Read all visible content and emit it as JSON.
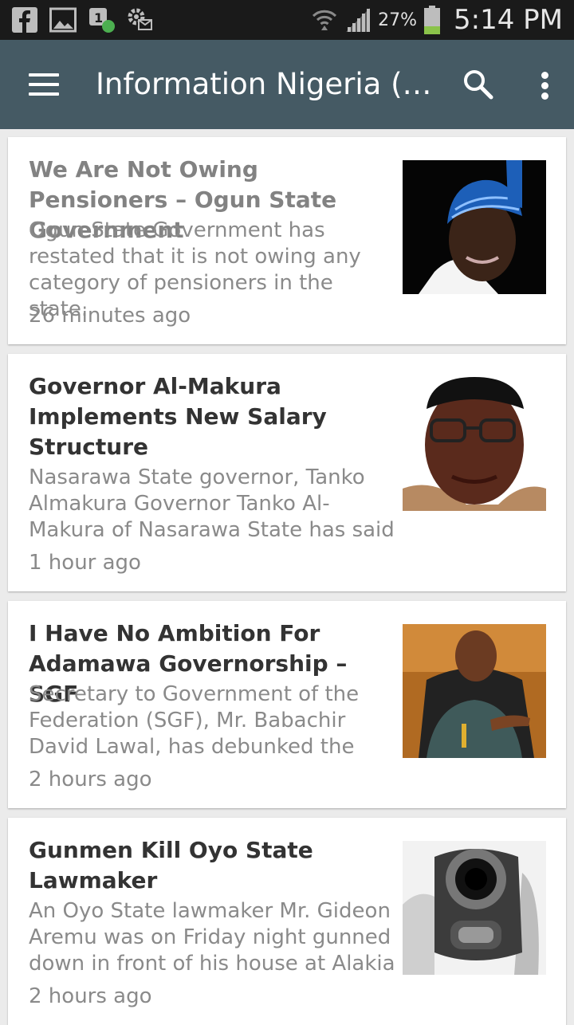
{
  "status_bar": {
    "icons": [
      "facebook-icon",
      "gallery-icon",
      "chat-notification-icon",
      "settings-notification-icon",
      "wifi-icon",
      "signal-icon",
      "battery-icon"
    ],
    "battery": "27%",
    "time": "5:14 PM"
  },
  "toolbar": {
    "title": "Information Nigeria (1…",
    "icons": [
      "menu-icon",
      "search-icon",
      "more-options-icon"
    ],
    "color": "#455a64"
  },
  "articles": [
    {
      "title": "We Are Not Owing Pensioners – Ogun State Government",
      "summary": "Ogun State Government has restated that it is not owing any category of pensioners in the state.",
      "time": "26 minutes ago",
      "thumbnail": "man-in-blue-cap-photo"
    },
    {
      "title": "Governor Al-Makura Implements New Salary Structure",
      "summary": "Nasarawa State governor, Tanko Almakura Governor Tanko Al-Makura of Nasarawa State has said",
      "time": "1 hour ago",
      "thumbnail": "man-with-glasses-photo"
    },
    {
      "title": "I Have No Ambition For Adamawa Governorship – SGF",
      "summary": "Secretary to Government of the Federation (SGF), Mr. Babachir David Lawal, has debunked the",
      "time": "2 hours ago",
      "thumbnail": "man-in-chair-photo"
    },
    {
      "title": "Gunmen Kill Oyo State Lawmaker",
      "summary": "An Oyo State lawmaker Mr. Gideon Aremu was on Friday night gunned down in front of his house at Alakia",
      "time": "2 hours ago",
      "thumbnail": "pistol-barrel-photo"
    }
  ]
}
